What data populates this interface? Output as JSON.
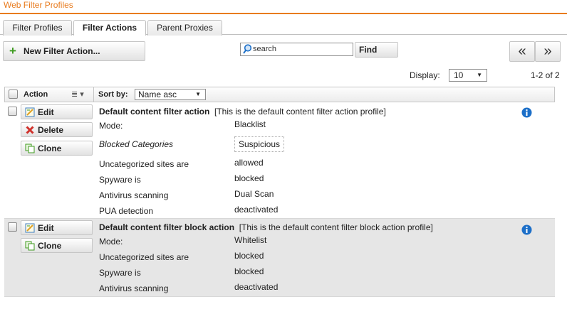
{
  "page": {
    "title": "Web Filter Profiles"
  },
  "tabs": [
    {
      "label": "Filter Profiles",
      "active": false
    },
    {
      "label": "Filter Actions",
      "active": true
    },
    {
      "label": "Parent Proxies",
      "active": false
    }
  ],
  "toolbar": {
    "new_label": "New Filter Action...",
    "search_placeholder": "search",
    "find_label": "Find",
    "prev_label": "«",
    "next_label": "»"
  },
  "pager": {
    "display_label": "Display:",
    "display_value": "10",
    "range_text": "1-2 of 2"
  },
  "grid": {
    "action_header": "Action",
    "sort_label": "Sort by:",
    "sort_value": "Name asc",
    "buttons": {
      "edit": "Edit",
      "delete": "Delete",
      "clone": "Clone"
    },
    "rows": [
      {
        "name": "Default content filter action",
        "comment": "[This is the default content filter action profile]",
        "mode_label": "Mode:",
        "mode_value": "Blacklist",
        "blocked_label": "Blocked Categories",
        "blocked_value": "Suspicious",
        "uncat_label": "Uncategorized sites are",
        "uncat_value": "allowed",
        "spyware_label": "Spyware is",
        "spyware_value": "blocked",
        "av_label": "Antivirus scanning",
        "av_value": "Dual Scan",
        "pua_label": "PUA detection",
        "pua_value": "deactivated"
      },
      {
        "name": "Default content filter block action",
        "comment": "[This is the default content filter block action profile]",
        "mode_label": "Mode:",
        "mode_value": "Whitelist",
        "uncat_label": "Uncategorized sites are",
        "uncat_value": "blocked",
        "spyware_label": "Spyware is",
        "spyware_value": "blocked",
        "av_label": "Antivirus scanning",
        "av_value": "deactivated"
      }
    ]
  },
  "colors": {
    "accent": "#e87b1e",
    "add_green": "#3d9a1e",
    "delete_red": "#d0302a",
    "info_blue": "#1c6fc8",
    "row_alt": "#e6e6e6"
  }
}
